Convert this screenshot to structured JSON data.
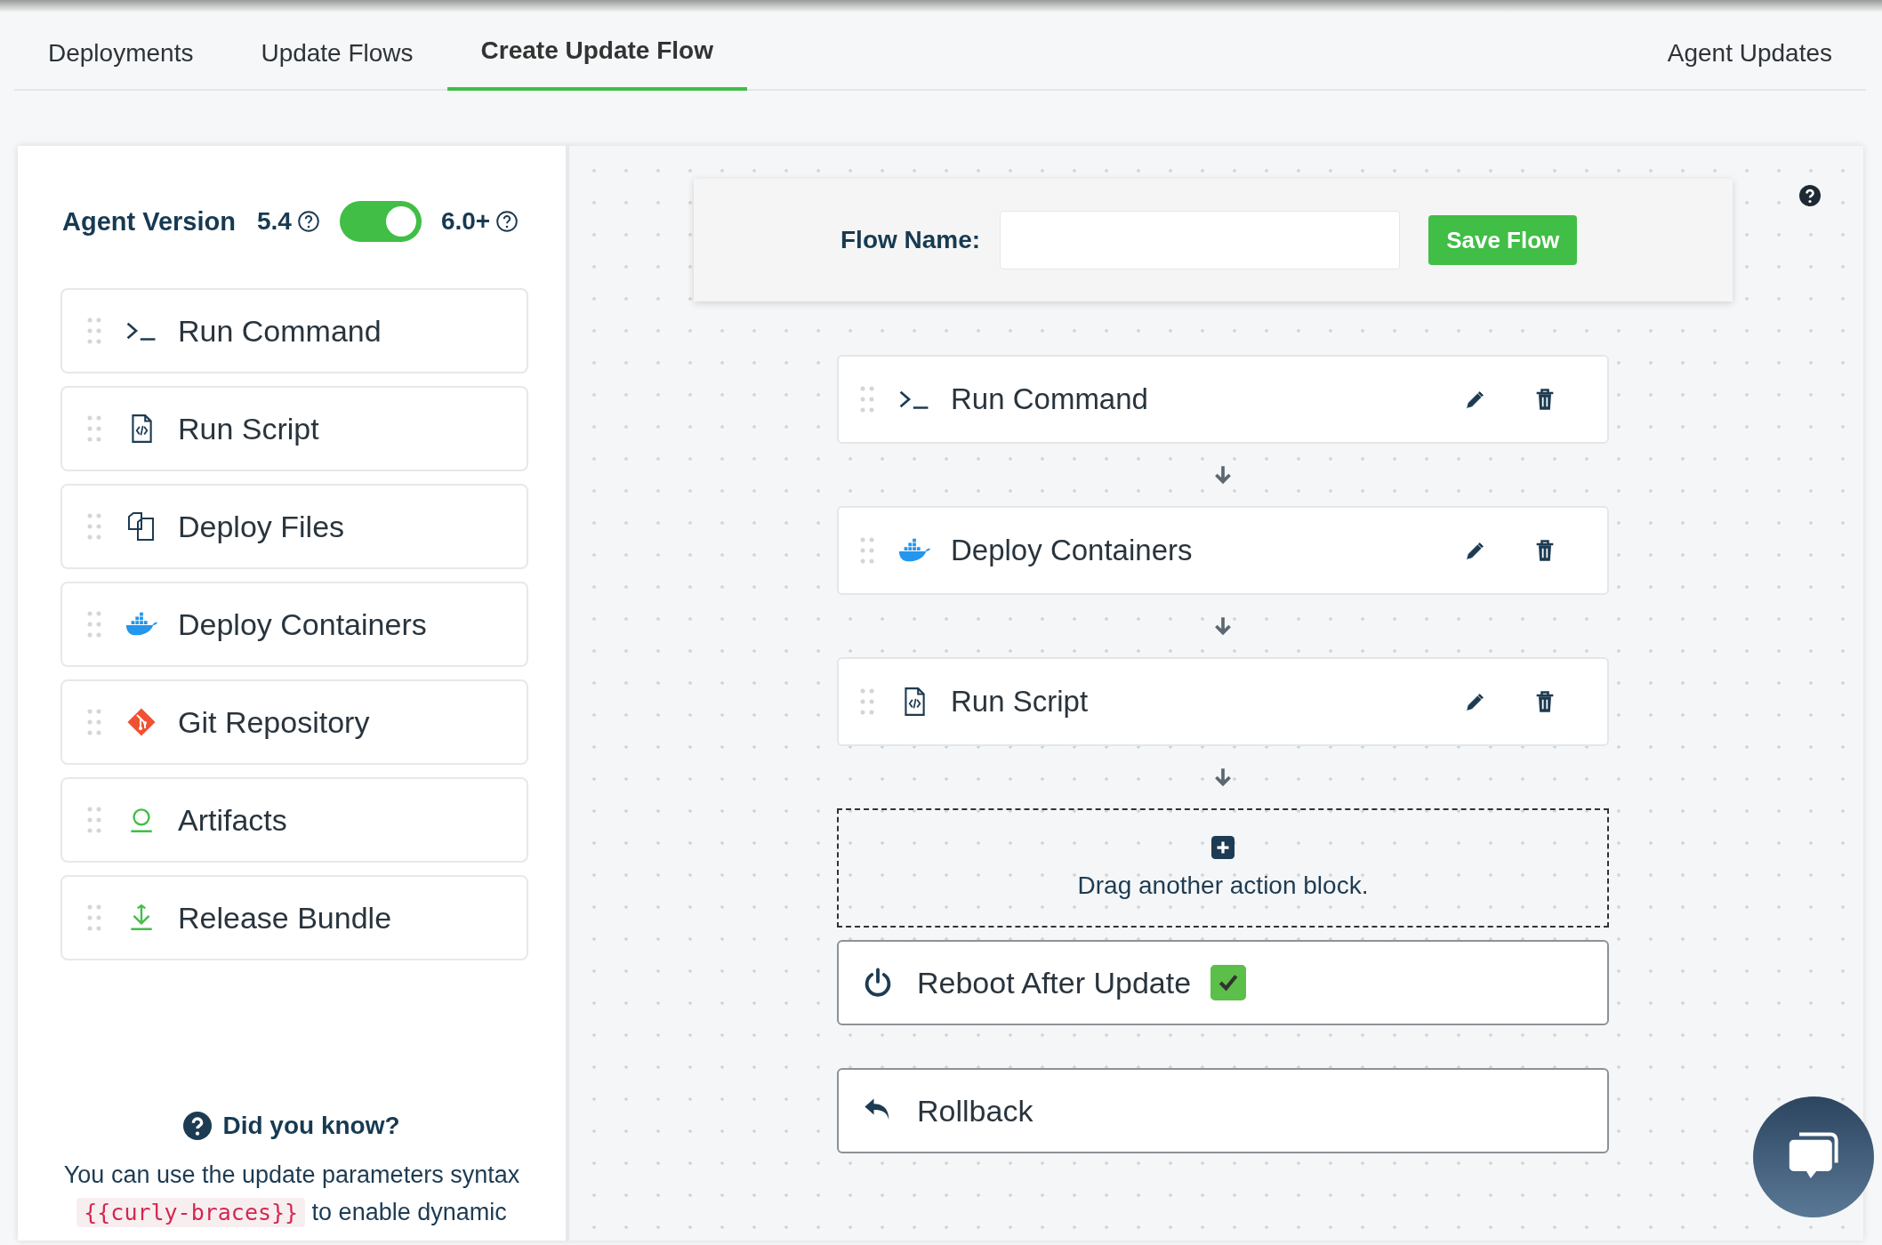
{
  "tabs": [
    {
      "label": "Deployments",
      "selected": false
    },
    {
      "label": "Update Flows",
      "selected": false
    },
    {
      "label": "Create Update Flow",
      "selected": true
    },
    {
      "label": "Agent Updates",
      "selected": false
    }
  ],
  "sidebar": {
    "agent_version": {
      "label": "Agent Version",
      "left_version": "5.4",
      "right_version": "6.0+",
      "on": true
    },
    "blocks": [
      {
        "kind": "command",
        "label": "Run Command"
      },
      {
        "kind": "script",
        "label": "Run Script"
      },
      {
        "kind": "files",
        "label": "Deploy Files"
      },
      {
        "kind": "containers",
        "label": "Deploy Containers"
      },
      {
        "kind": "git",
        "label": "Git Repository"
      },
      {
        "kind": "artifacts",
        "label": "Artifacts"
      },
      {
        "kind": "bundle",
        "label": "Release Bundle"
      }
    ],
    "tip": {
      "title": "Did you know?",
      "text_before": "You can use the update parameters syntax",
      "code": "{{curly-braces}}",
      "text_after": "to enable dynamic"
    }
  },
  "flow": {
    "name_label": "Flow Name:",
    "save_button": "Save Flow",
    "steps": [
      {
        "kind": "command",
        "label": "Run Command"
      },
      {
        "kind": "containers",
        "label": "Deploy Containers"
      },
      {
        "kind": "script",
        "label": "Run Script"
      }
    ],
    "drop_zone": "Drag another action block.",
    "reboot": {
      "label": "Reboot After Update",
      "checked": true
    },
    "rollback": {
      "label": "Rollback"
    }
  }
}
